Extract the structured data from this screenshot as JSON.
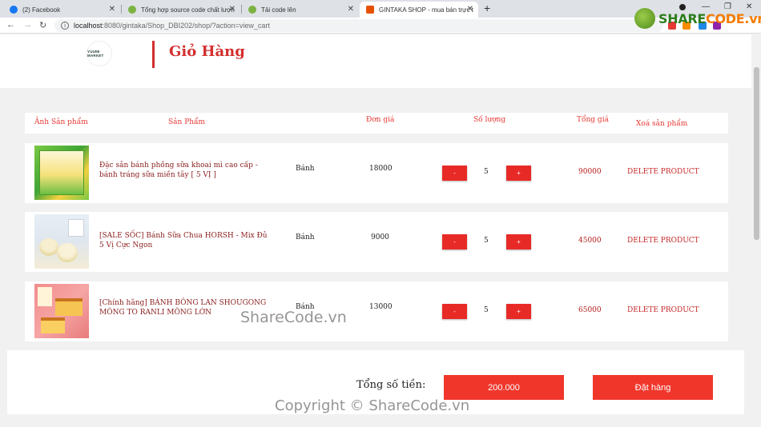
{
  "browser": {
    "tabs": [
      {
        "title": "(2) Facebook",
        "color": "#1877f2"
      },
      {
        "title": "Tổng hợp source code chất lượn",
        "color": "#7cb342"
      },
      {
        "title": "Tải code lên",
        "color": "#7cb342"
      },
      {
        "title": "GINTAKA SHOP - mua bán trực t",
        "color": "#e65100"
      }
    ],
    "url_host": "localhost",
    "url_path": ":8080/gintaka/Shop_DBI202/shop/?action=view_cart"
  },
  "watermark_logo": {
    "brand_left": "SHARE",
    "brand_right": "CODE.vn"
  },
  "header": {
    "logo_text": "YUUMI MARKET",
    "title": "Giỏ Hàng"
  },
  "cart_columns": {
    "image": "Ảnh Sản phẩm",
    "product": "Sản Phẩm",
    "price": "Đơn giá",
    "quantity": "Số lượng",
    "total": "Tổng giá",
    "remove": "Xoá sản phẩm"
  },
  "cart_items": [
    {
      "name": "Đặc sản bánh phồng sữa khoai mì cao cấp - bánh tráng sữa miền tây [ 5 VỊ ]",
      "category": "Bánh",
      "price": "18000",
      "minus": "-",
      "quantity": "5",
      "plus": "+",
      "total": "90000",
      "delete": "DELETE PRODUCT"
    },
    {
      "name": "[SALE SỐC] Bánh Sữa Chua HORSH - Mix Đủ 5 Vị Cực Ngon",
      "category": "Bánh",
      "price": "9000",
      "minus": "-",
      "quantity": "5",
      "plus": "+",
      "total": "45000",
      "delete": "DELETE PRODUCT"
    },
    {
      "name": "[Chính hãng] BÁNH BÔNG LAN SHOUGONG MÔNG TO RANLI MÔNG LỚN",
      "category": "Bánh",
      "price": "13000",
      "minus": "-",
      "quantity": "5",
      "plus": "+",
      "total": "65000",
      "delete": "DELETE PRODUCT"
    }
  ],
  "footer": {
    "total_label": "Tổng số tiền:",
    "total_value": "200.000",
    "order_button": "Đặt hàng"
  },
  "watermarks": {
    "center": "ShareCode.vn",
    "bottom": "Copyright © ShareCode.vn"
  },
  "colors": {
    "accent": "#f0362b",
    "title_red": "#d32f2f"
  }
}
